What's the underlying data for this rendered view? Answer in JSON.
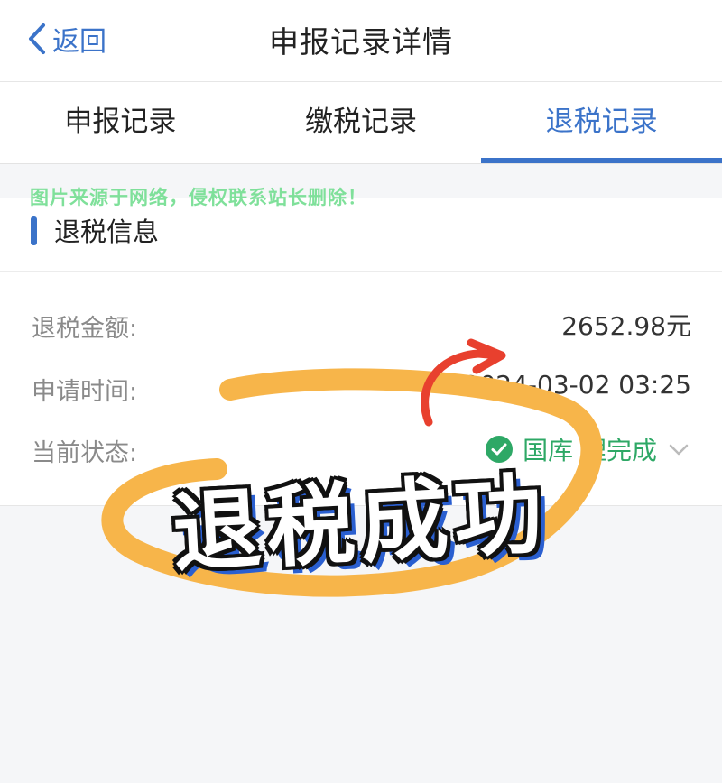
{
  "navbar": {
    "back_label": "返回",
    "title": "申报记录详情"
  },
  "tabs": [
    {
      "label": "申报记录",
      "active": false
    },
    {
      "label": "缴税记录",
      "active": false
    },
    {
      "label": "退税记录",
      "active": true
    }
  ],
  "watermark": "图片来源于网络，侵权联系站长删除！",
  "section": {
    "title": "退税信息"
  },
  "info": {
    "amount_label": "退税金额:",
    "amount_value": "2652.98元",
    "time_label": "申请时间:",
    "time_value": "2024-03-02 03:25",
    "status_label": "当前状态:",
    "status_value": "国库 理完成"
  },
  "sticker": {
    "text": "退税成功"
  },
  "colors": {
    "accent": "#3b73c9",
    "status_green": "#2ea866",
    "marker_orange": "#f7b54a",
    "arrow_red": "#e8402e",
    "watermark_green": "#7fe09a"
  },
  "icons": {
    "back": "chevron-left-icon",
    "status_check": "check-circle-icon",
    "status_expand": "chevron-down-icon"
  }
}
